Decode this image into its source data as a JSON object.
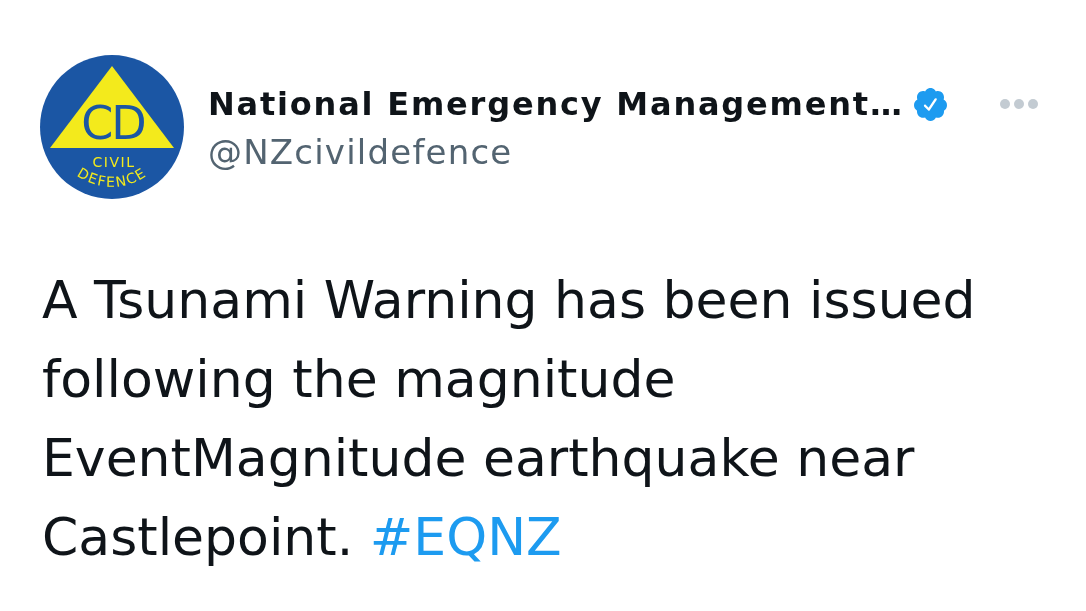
{
  "tweet": {
    "avatar": {
      "logo_mark": "CD",
      "logo_lines": [
        "CIVIL",
        "DEFENCE"
      ]
    },
    "author": {
      "name": "National Emergency Management…",
      "verified": true,
      "handle": "@NZcivildefence"
    },
    "body": {
      "text": "A Tsunami Warning has been issued following the magnitude EventMagnitude earthquake near Castlepoint. ",
      "hashtag": "#EQNZ"
    }
  }
}
